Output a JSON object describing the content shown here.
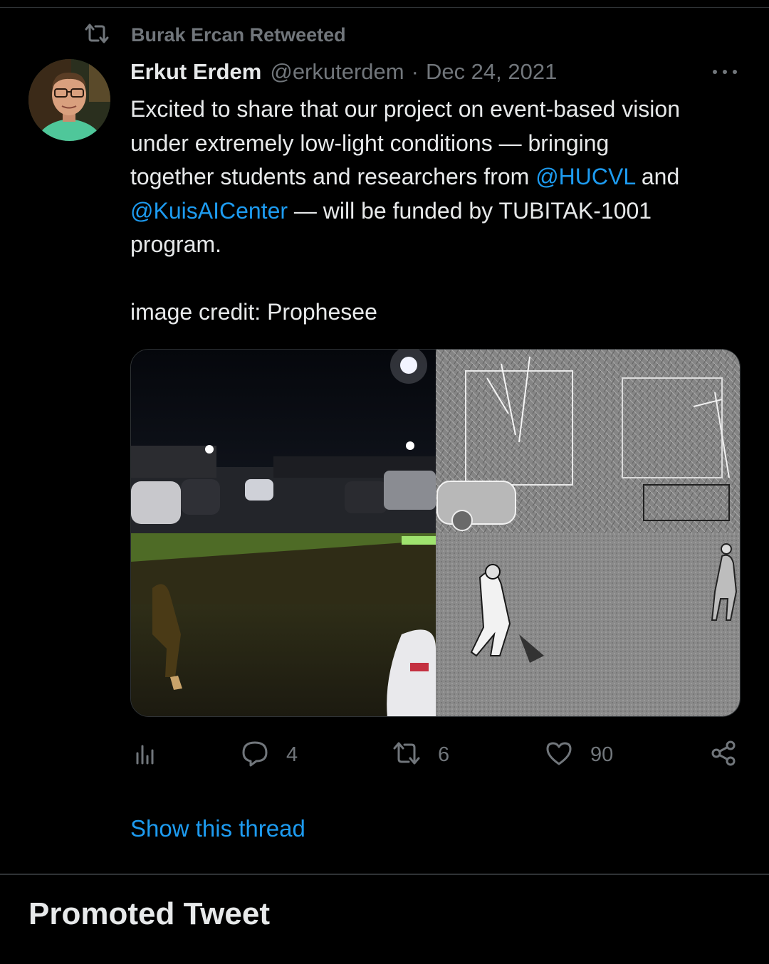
{
  "social_context": {
    "retweeted_by": "Burak Ercan Retweeted",
    "icon": "retweet-icon"
  },
  "tweet": {
    "author_name": "Erkut Erdem",
    "author_handle": "@erkuterdem",
    "separator": "·",
    "date": "Dec 24, 2021",
    "more_icon": "more-dots-icon",
    "text_lines": [
      {
        "parts": [
          {
            "text": "Excited to share that our project on event-based vision",
            "mention": false
          }
        ]
      },
      {
        "parts": [
          {
            "text": "under extremely low-light conditions — bringing",
            "mention": false
          }
        ]
      },
      {
        "parts": [
          {
            "text": "together students and researchers from ",
            "mention": false
          },
          {
            "text": "@HUCVL",
            "mention": true
          },
          {
            "text": " and",
            "mention": false
          }
        ]
      },
      {
        "parts": [
          {
            "text": "@KuisAICenter",
            "mention": true
          },
          {
            "text": " — will be funded by TUBITAK-1001",
            "mention": false
          }
        ]
      },
      {
        "parts": [
          {
            "text": "program.",
            "mention": false
          }
        ]
      }
    ],
    "credit": "image credit: Prophesee",
    "media_description_icon": "image-grid-icon"
  },
  "actions": {
    "analytics": {
      "icon": "analytics-icon",
      "count": ""
    },
    "reply": {
      "icon": "reply-icon",
      "count": "4"
    },
    "retweet": {
      "icon": "retweet-icon",
      "count": "6"
    },
    "like": {
      "icon": "heart-icon",
      "count": "90"
    },
    "share": {
      "icon": "share-icon",
      "count": ""
    }
  },
  "show_thread": "Show this thread",
  "promoted_heading": "Promoted Tweet",
  "colors": {
    "background": "#000000",
    "primary_text": "#e7e9ea",
    "secondary_text": "#71767b",
    "link": "#1d9bf0",
    "divider": "#2f3336"
  }
}
